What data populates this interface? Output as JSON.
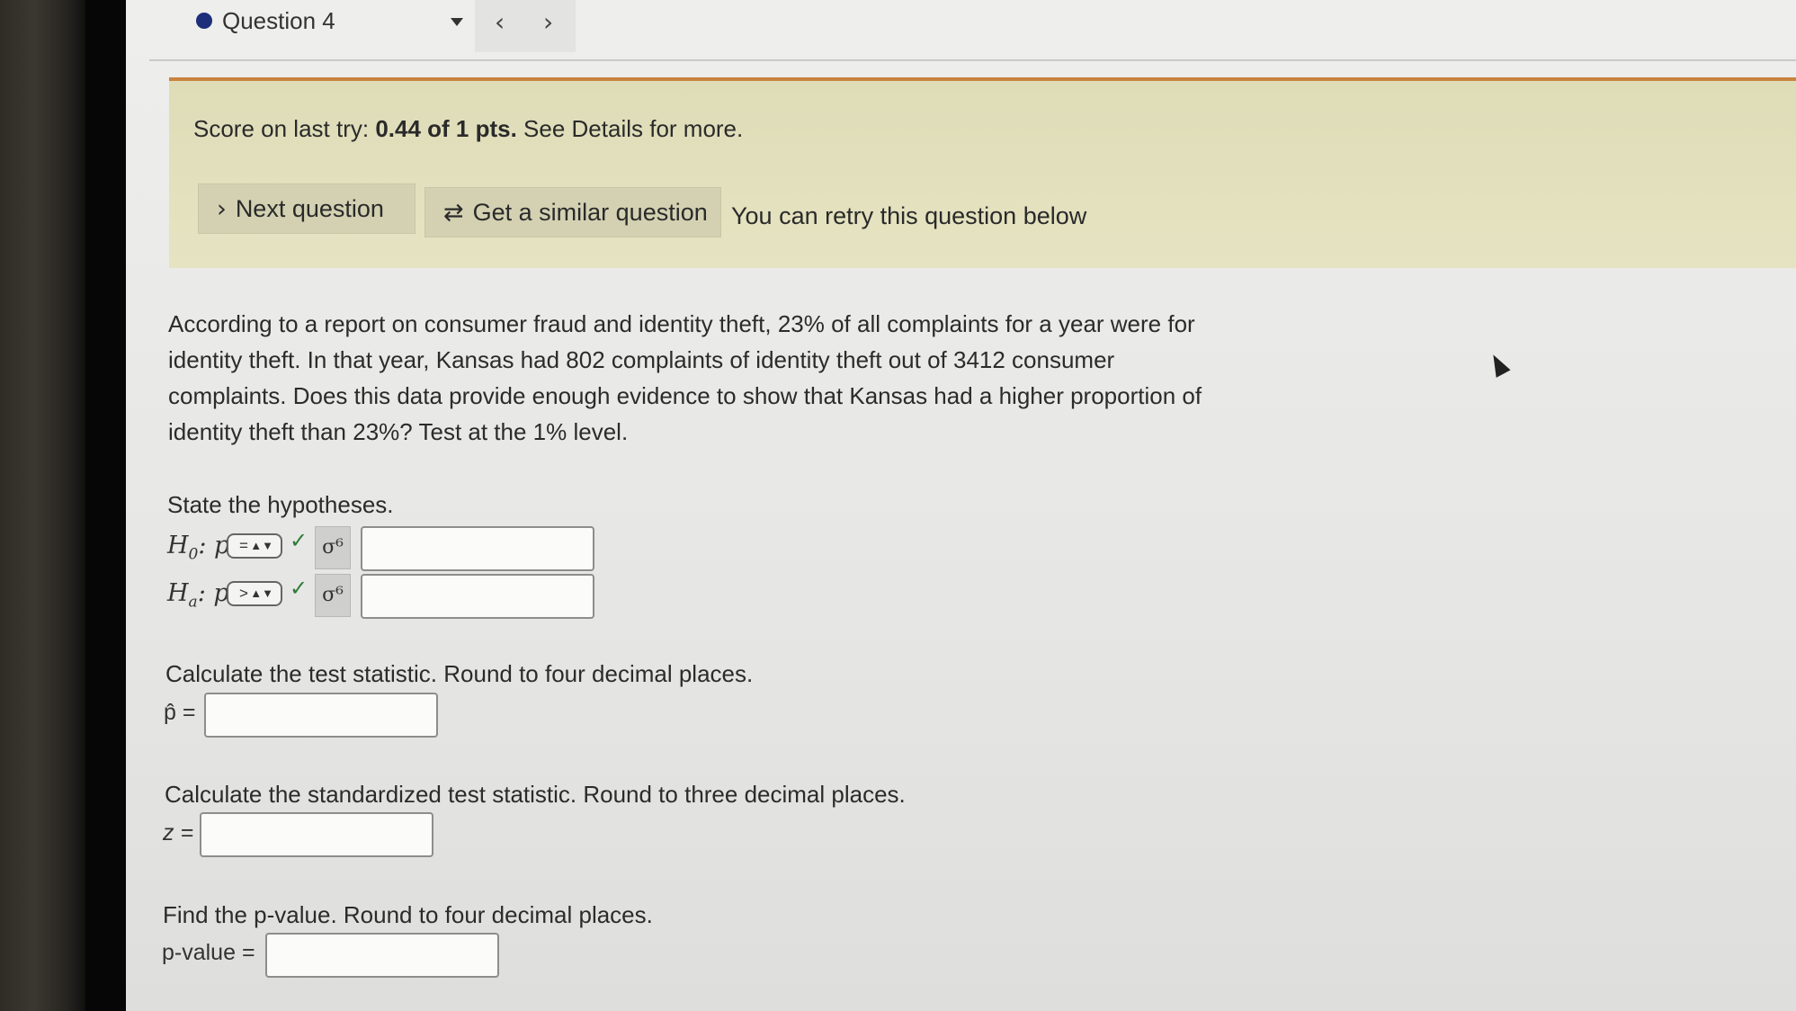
{
  "nav": {
    "question_label": "Question 4",
    "prev_glyph": "‹",
    "next_glyph": "›"
  },
  "banner": {
    "score_prefix": "Score on last try: ",
    "score_value": "0.44 of 1 pts.",
    "score_suffix": " See Details for more.",
    "next_button": "Next question",
    "similar_button": "Get a similar question",
    "retry_text": "You can retry this question below"
  },
  "problem": {
    "text": "According to a report on consumer fraud and identity theft, 23% of all complaints for a year were for identity theft. In that year, Kansas had 802 complaints of identity theft out of 3412 consumer complaints. Does this data provide enough evidence to show that Kansas had a higher proportion of identity theft than 23%? Test at the 1% level."
  },
  "hypotheses": {
    "prompt": "State the hypotheses.",
    "h0": {
      "base": "H",
      "sub": "0",
      "suffix": ": p",
      "operator": "=",
      "value": ""
    },
    "ha": {
      "base": "H",
      "sub": "a",
      "suffix": ": p",
      "operator": ">",
      "value": ""
    },
    "symbol_glyph": "σ⁶"
  },
  "test_statistic": {
    "prompt": "Calculate the test statistic. Round to four decimal places.",
    "label": "p̂ =",
    "value": ""
  },
  "z_statistic": {
    "prompt": "Calculate the standardized test statistic. Round to three decimal places.",
    "label": "z =",
    "value": ""
  },
  "p_value": {
    "prompt": "Find the p-value. Round to four decimal places.",
    "label": "p-value =",
    "value": ""
  },
  "colors": {
    "banner_bg": "#e0deba",
    "banner_border": "#c9833f",
    "question_dot": "#1d2f7a",
    "check": "#2f7a3a"
  }
}
